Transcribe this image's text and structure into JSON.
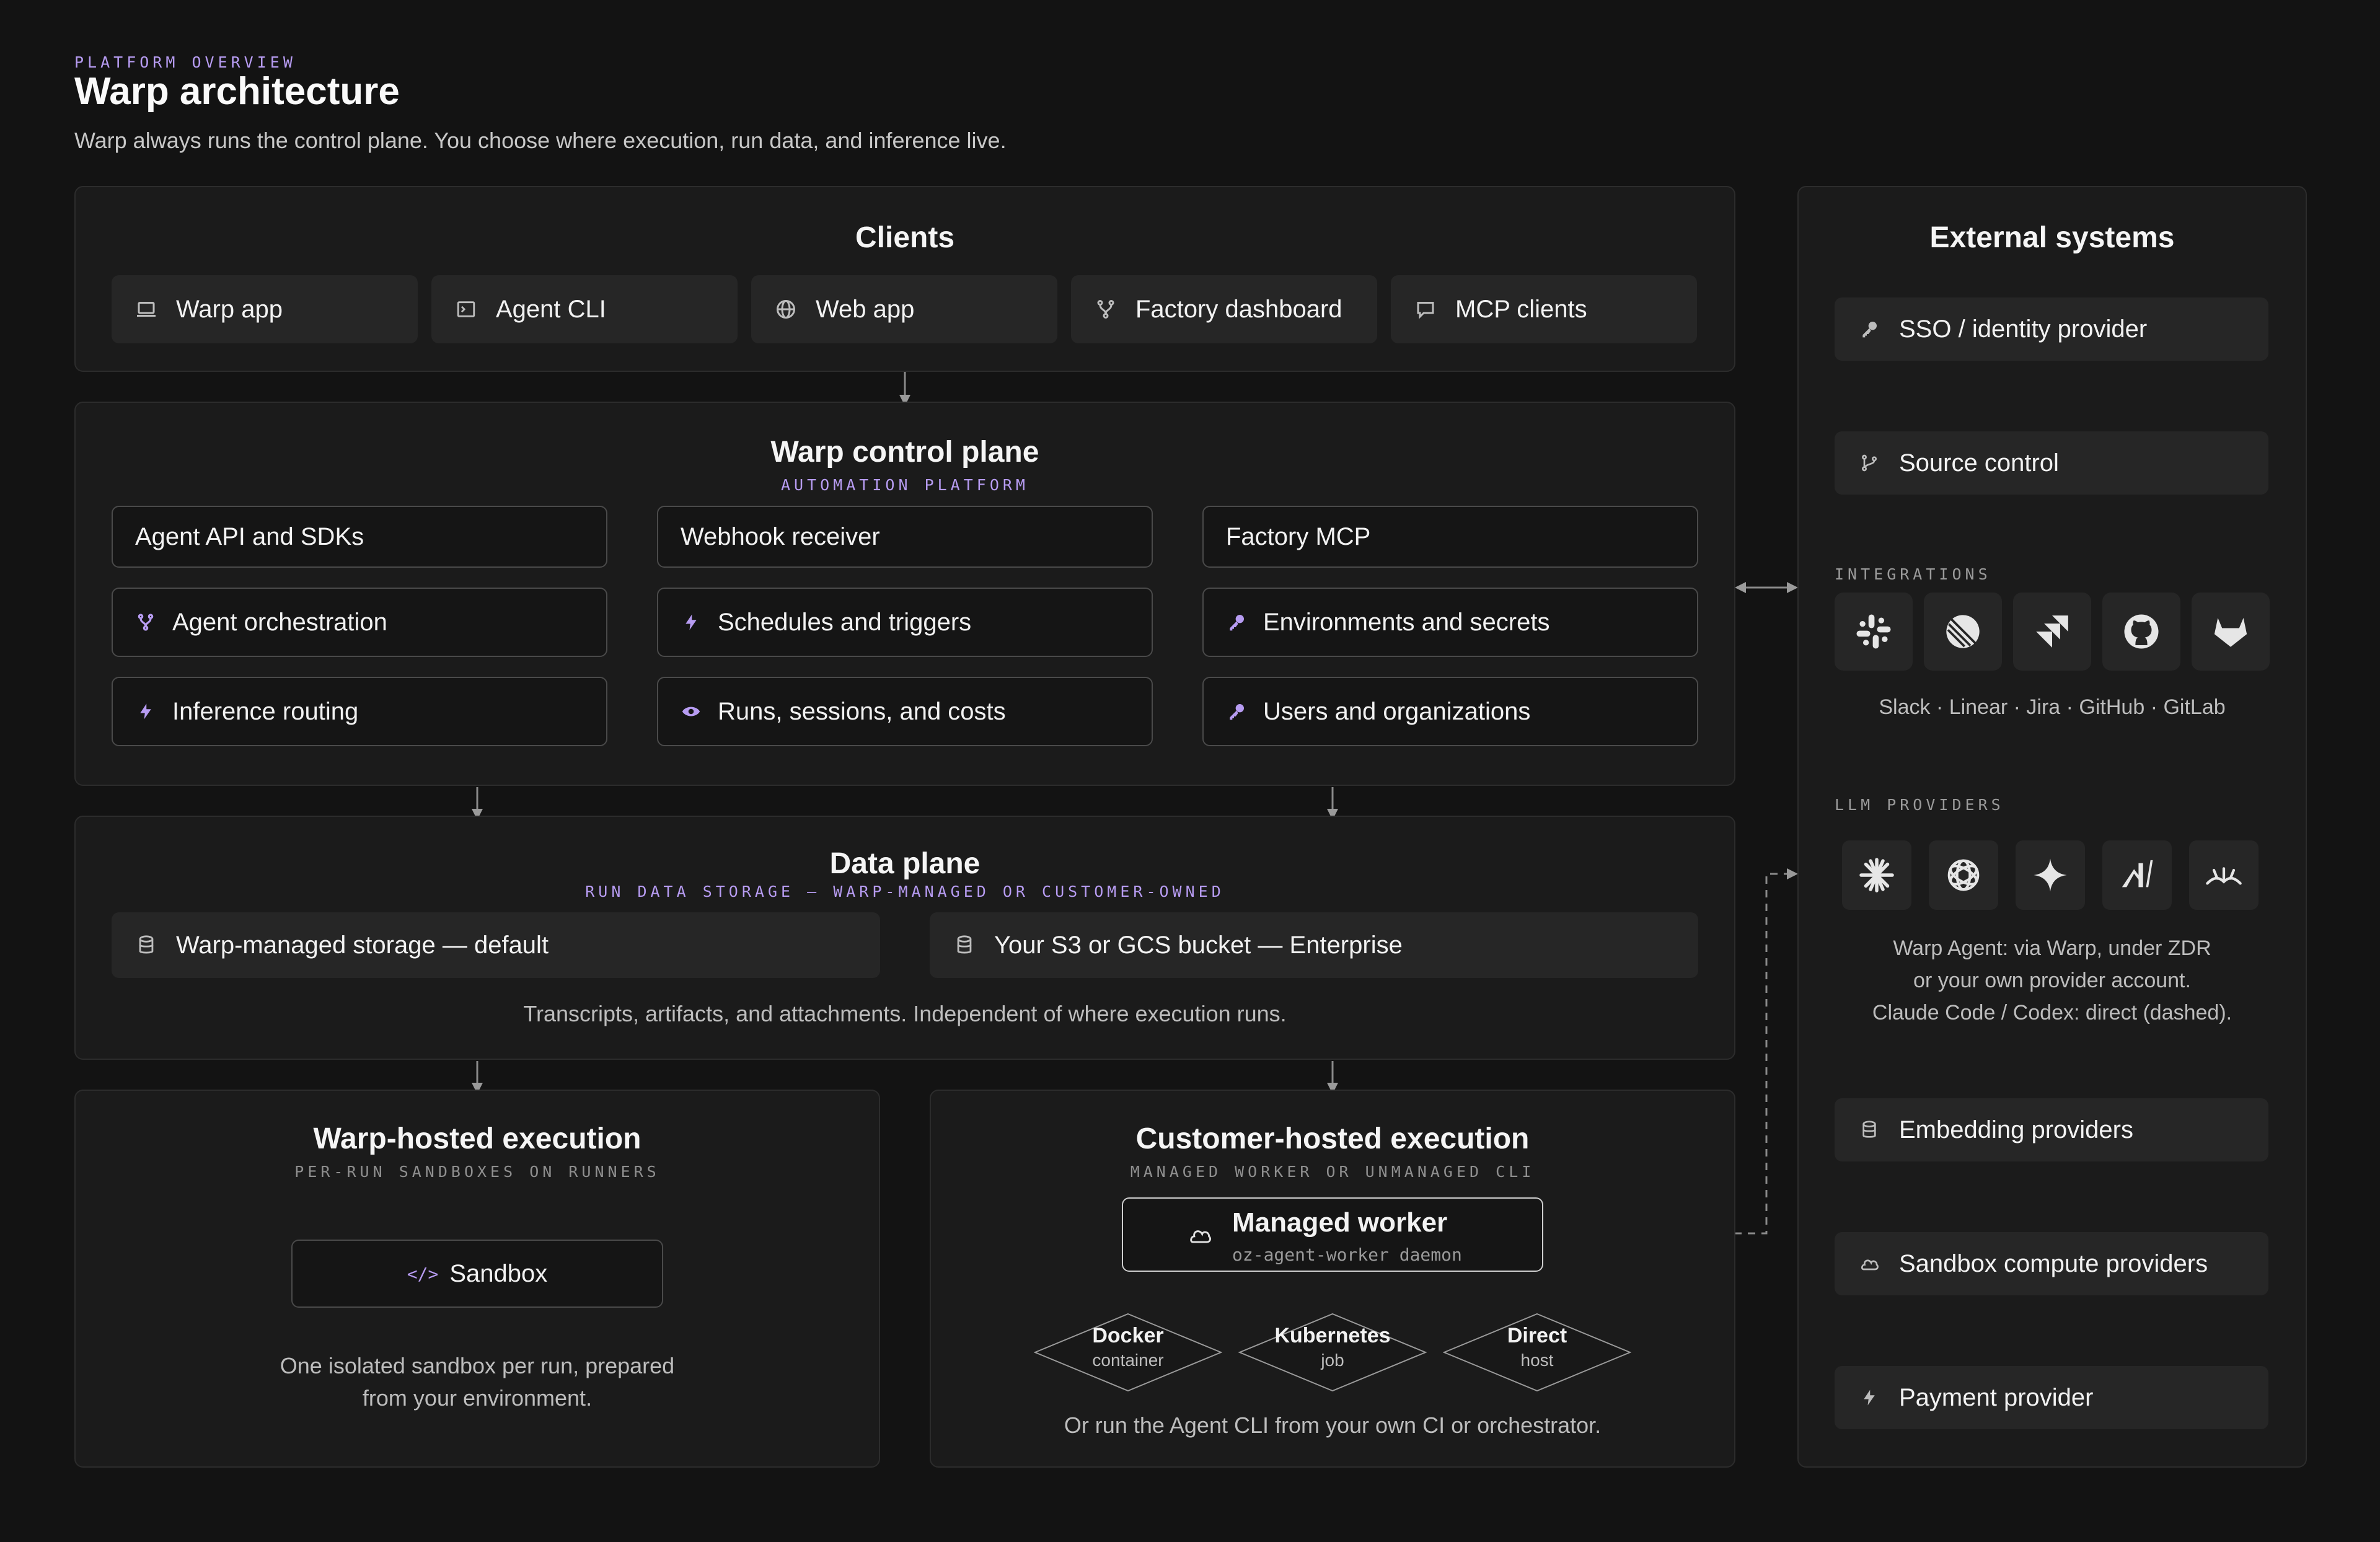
{
  "header": {
    "eyebrow": "PLATFORM OVERVIEW",
    "title": "Warp architecture",
    "subtitle": "Warp always runs the control plane. You choose where execution, run data, and inference live."
  },
  "clients": {
    "title": "Clients",
    "items": [
      {
        "label": "Warp app",
        "icon": "laptop-icon"
      },
      {
        "label": "Agent CLI",
        "icon": "terminal-icon"
      },
      {
        "label": "Web app",
        "icon": "globe-icon"
      },
      {
        "label": "Factory dashboard",
        "icon": "branch-icon"
      },
      {
        "label": "MCP clients",
        "icon": "chat-icon"
      }
    ]
  },
  "control_plane": {
    "title": "Warp control plane",
    "subtitle": "AUTOMATION PLATFORM",
    "items": [
      {
        "label": "Agent API and SDKs",
        "icon": ""
      },
      {
        "label": "Webhook receiver",
        "icon": ""
      },
      {
        "label": "Factory MCP",
        "icon": ""
      },
      {
        "label": "Agent orchestration",
        "icon": "branch-icon"
      },
      {
        "label": "Schedules and triggers",
        "icon": "bolt-icon"
      },
      {
        "label": "Environments and secrets",
        "icon": "key-icon"
      },
      {
        "label": "Inference routing",
        "icon": "bolt-icon"
      },
      {
        "label": "Runs, sessions, and costs",
        "icon": "eye-icon"
      },
      {
        "label": "Users and organizations",
        "icon": "key-icon"
      }
    ]
  },
  "data_plane": {
    "title": "Data plane",
    "subtitle": "RUN DATA STORAGE — WARP-MANAGED OR CUSTOMER-OWNED",
    "items": [
      {
        "label": "Warp-managed storage — default",
        "icon": "database-icon"
      },
      {
        "label": "Your S3 or GCS bucket — Enterprise",
        "icon": "database-icon"
      }
    ],
    "note": "Transcripts, artifacts, and attachments. Independent of where execution runs."
  },
  "warp_hosted": {
    "title": "Warp-hosted execution",
    "subtitle": "PER-RUN SANDBOXES ON RUNNERS",
    "sandbox_label": "Sandbox",
    "sandbox_icon_text": "</>",
    "note_line1": "One isolated sandbox per run, prepared",
    "note_line2": "from your environment."
  },
  "customer_hosted": {
    "title": "Customer-hosted execution",
    "subtitle": "MANAGED WORKER OR UNMANAGED CLI",
    "worker_label": "Managed worker",
    "worker_sub": "oz-agent-worker daemon",
    "targets": [
      {
        "label": "Docker",
        "sub": "container"
      },
      {
        "label": "Kubernetes",
        "sub": "job"
      },
      {
        "label": "Direct",
        "sub": "host"
      }
    ],
    "note": "Or run the Agent CLI from your own CI or orchestrator."
  },
  "external": {
    "title": "External systems",
    "sso": {
      "label": "SSO / identity provider",
      "icon": "key-icon"
    },
    "source_control": {
      "label": "Source control",
      "icon": "branch-icon"
    },
    "integrations_label": "INTEGRATIONS",
    "integrations": [
      "slack-icon",
      "linear-icon",
      "jira-icon",
      "github-icon",
      "gitlab-icon"
    ],
    "integrations_caption": "Slack · Linear · Jira · GitHub · GitLab",
    "llm_label": "LLM PROVIDERS",
    "llms": [
      "anthropic-icon",
      "openai-icon",
      "gemini-icon",
      "mistral-icon",
      "provider-icon"
    ],
    "llm_line1": "Warp Agent: via Warp, under ZDR",
    "llm_line2": "or your own provider account.",
    "llm_line3": "Claude Code / Codex: direct (dashed).",
    "embedding": {
      "label": "Embedding providers",
      "icon": "database-icon"
    },
    "sandbox_compute": {
      "label": "Sandbox compute providers",
      "icon": "cloud-icon"
    },
    "payment": {
      "label": "Payment provider",
      "icon": "bolt-icon"
    }
  },
  "colors": {
    "background": "#131313",
    "panel": "#1b1b1b",
    "accent": "#b79cf2",
    "muted_text": "#bdbdbd",
    "connector": "#8a8a8a"
  }
}
